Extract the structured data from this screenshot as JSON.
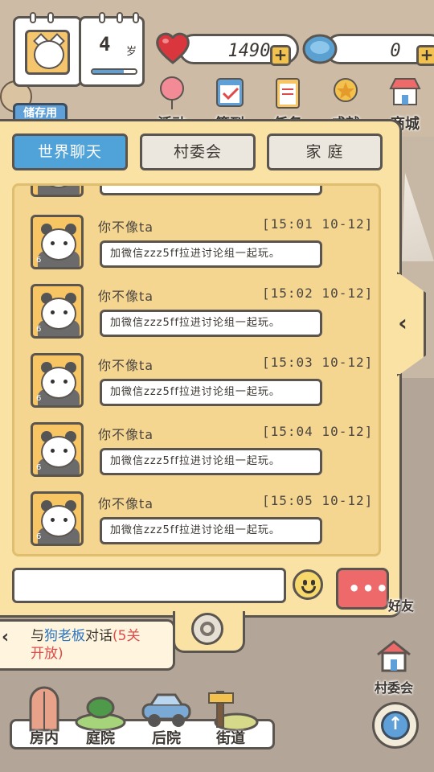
{
  "profile": {
    "age_value": "4",
    "age_unit": "岁",
    "age_progress": 0.72
  },
  "currencies": {
    "hearts": {
      "value": "1490",
      "plus": "+"
    },
    "gems": {
      "value": "0",
      "plus": "+"
    }
  },
  "top_nav": {
    "warehouse": "储存用",
    "items": [
      {
        "label": "活动",
        "icon": "balloon-icon"
      },
      {
        "label": "签到",
        "icon": "calendar-check-icon"
      },
      {
        "label": "任务",
        "icon": "clipboard-icon"
      },
      {
        "label": "成就",
        "icon": "medal-icon"
      },
      {
        "label": "商城",
        "icon": "shop-icon"
      }
    ]
  },
  "chat": {
    "tabs": [
      {
        "label": "世界聊天",
        "active": true
      },
      {
        "label": "村委会",
        "active": false
      },
      {
        "label": "家 庭",
        "active": false
      }
    ],
    "partial_message": "加微信zzz5ff拉进讨论组一起玩。",
    "messages": [
      {
        "name": "你不像ta",
        "time": "[15:01 10-12]",
        "text": "加微信zzz5ff拉进讨论组一起玩。",
        "level": "6"
      },
      {
        "name": "你不像ta",
        "time": "[15:02 10-12]",
        "text": "加微信zzz5ff拉进讨论组一起玩。",
        "level": "6"
      },
      {
        "name": "你不像ta",
        "time": "[15:03 10-12]",
        "text": "加微信zzz5ff拉进讨论组一起玩。",
        "level": "6"
      },
      {
        "name": "你不像ta",
        "time": "[15:04 10-12]",
        "text": "加微信zzz5ff拉进讨论组一起玩。",
        "level": "6"
      },
      {
        "name": "你不像ta",
        "time": "[15:05 10-12]",
        "text": "加微信zzz5ff拉进讨论组一起玩。",
        "level": "6"
      }
    ],
    "input_value": "",
    "send_label": "•••",
    "handle_arrow": "‹"
  },
  "task": {
    "prefix": "与",
    "npc": "狗老板",
    "suffix": "对话",
    "lock_note": "(5关",
    "line2": "开放)",
    "arrow": "‹"
  },
  "side": {
    "village_label": "村委会",
    "friend_label_partial": "好友",
    "up_arrow": "↑"
  },
  "bottom_nav": [
    {
      "label": "房内",
      "icon": "door-icon"
    },
    {
      "label": "庭院",
      "icon": "garden-icon"
    },
    {
      "label": "后院",
      "icon": "car-icon"
    },
    {
      "label": "街道",
      "icon": "signpost-icon"
    }
  ],
  "colors": {
    "panel_bg": "#fae2a4",
    "active_tab": "#4fa3d9",
    "send_button": "#ee6a6a",
    "outline": "#5b5550"
  }
}
